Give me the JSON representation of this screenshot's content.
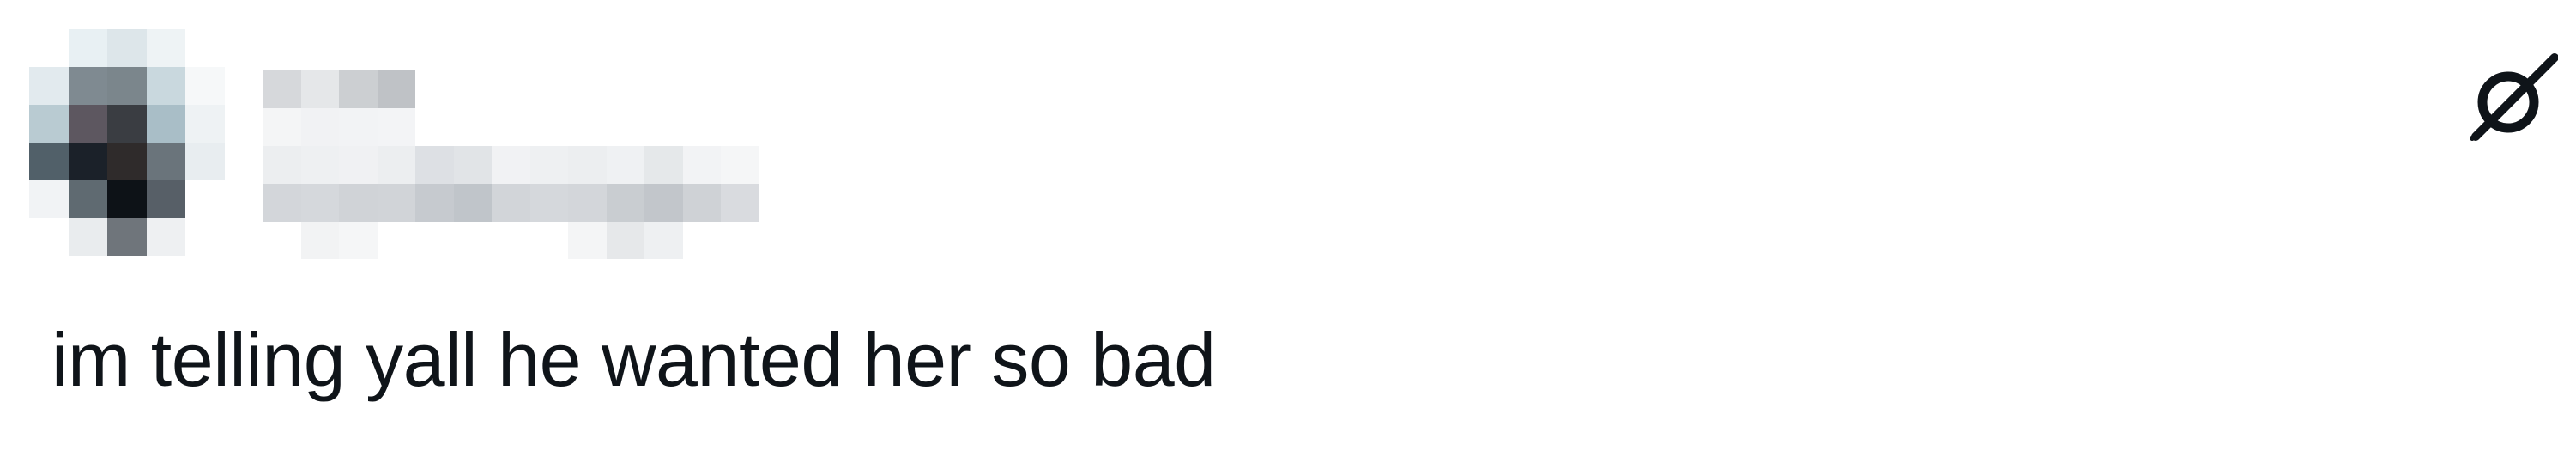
{
  "tweet": {
    "text": "im telling yall he wanted her so bad"
  },
  "header": {
    "grok_button": {
      "icon": "grok-slash-icon"
    }
  },
  "colors": {
    "text": "#0f1419",
    "icon": "#0f1419",
    "background": "#ffffff"
  }
}
